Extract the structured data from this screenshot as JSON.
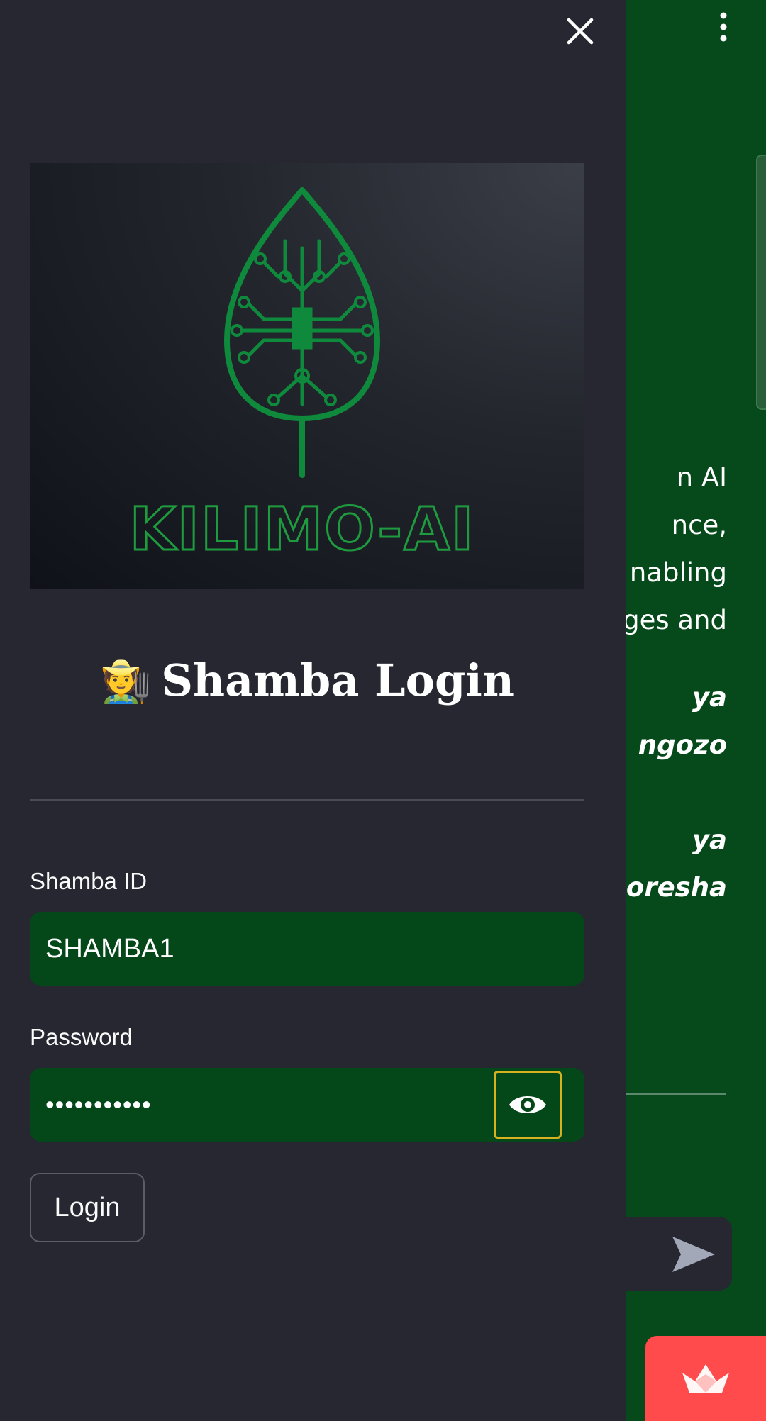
{
  "main": {
    "text_lines": [
      "n AI",
      "nce,",
      "nabling",
      "ges and"
    ],
    "italic_lines": [
      "ya",
      "ngozo",
      "ya",
      "boresha"
    ]
  },
  "sidebar": {
    "logo_text": "KILIMO-AI",
    "title": {
      "emoji": "🧑‍🌾",
      "text": "Shamba Login"
    },
    "shamba_id": {
      "label": "Shamba ID",
      "value": "SHAMBA1"
    },
    "password": {
      "label": "Password",
      "value_masked": "•••••••••••"
    },
    "login_button_label": "Login"
  },
  "colors": {
    "main_background": "#064a1c",
    "sidebar_background": "#262730",
    "input_background": "#04481a",
    "logo_green": "#0f8a3c",
    "focus_ring": "#d6b220",
    "badge_red": "#ff4b4b"
  },
  "icons": {
    "close": "close-icon",
    "menu": "kebab-menu-icon",
    "show_password": "eye-icon",
    "send": "send-icon",
    "badge": "streamlit-crown-icon"
  }
}
